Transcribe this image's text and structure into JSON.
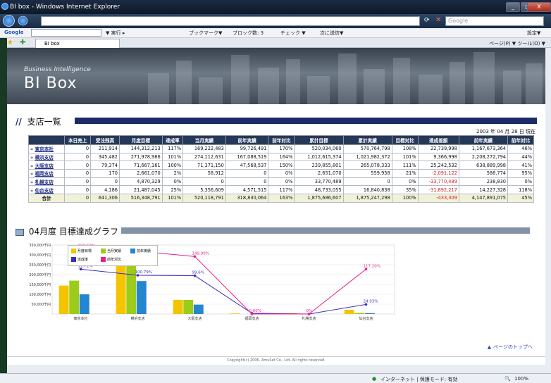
{
  "window": {
    "title": "BI box - Windows Internet Explorer",
    "min": "_",
    "max": "□",
    "close": "X"
  },
  "address": {
    "url": "",
    "search_placeholder": "Google"
  },
  "google_toolbar": {
    "brand": "Google",
    "items": [
      "▼ 実行 ▸",
      "ブックマーク▼",
      "ブロック数: 3",
      "チェック ▼",
      "次に送信▼"
    ],
    "settings": "設定▼"
  },
  "tabs": {
    "active": "BI box",
    "commands": "ページ(P) ▼ ツール(O) ▼"
  },
  "banner": {
    "subtitle": "Business Intelligence",
    "title": "BI Box"
  },
  "section1": {
    "title": "支店一覧"
  },
  "report_date": "2003 年 04 月 28 日 現在",
  "table": {
    "headers": [
      "",
      "本日売上",
      "受注残高",
      "月度目標",
      "達成率",
      "当月実績",
      "前年実績",
      "前年対比",
      "累計目標",
      "累計実績",
      "目標対比",
      "達成差額",
      "前年実績",
      "前年対比"
    ],
    "rows": [
      [
        "東京本社",
        "0",
        "211,914",
        "144,312,213",
        "117%",
        "169,222,483",
        "99,726,491",
        "170%",
        "520,034,060",
        "570,764,798",
        "108%",
        "22,739,998",
        "1,167,673,364",
        "46%"
      ],
      [
        "横浜支店",
        "0",
        "345,482",
        "271,978,986",
        "101%",
        "274,112,631",
        "167,088,519",
        "164%",
        "1,012,615,374",
        "1,021,982,372",
        "101%",
        "9,366,998",
        "2,208,272,794",
        "44%"
      ],
      [
        "大阪支店",
        "0",
        "79,374",
        "71,667,161",
        "100%",
        "71,371,150",
        "47,568,537",
        "150%",
        "239,855,801",
        "265,078,333",
        "111%",
        "25,242,532",
        "638,889,998",
        "41%"
      ],
      [
        "福岡支店",
        "0",
        "170",
        "2,661,070",
        "2%",
        "58,912",
        "0",
        "0%",
        "2,651,070",
        "559,958",
        "21%",
        "-2,091,122",
        "588,774",
        "95%"
      ],
      [
        "札幌支店",
        "0",
        "0",
        "4,870,329",
        "0%",
        "0",
        "0",
        "0%",
        "33,770,489",
        "0",
        "0%",
        "-33,770,489",
        "238,830",
        "0%"
      ],
      [
        "仙台支店",
        "0",
        "4,186",
        "21,487,045",
        "25%",
        "5,356,609",
        "4,571,515",
        "117%",
        "48,733,055",
        "16,840,838",
        "35%",
        "-31,892,217",
        "14,227,328",
        "118%"
      ],
      [
        "合計",
        "0",
        "641,306",
        "516,348,791",
        "101%",
        "520,118,791",
        "318,830,064",
        "163%",
        "1,875,686,607",
        "1,875,247,298",
        "100%",
        "-433,309",
        "4,147,891,075",
        "45%"
      ]
    ]
  },
  "section2": {
    "title": "04月度 目標達成グラフ"
  },
  "chart_data": {
    "type": "bar",
    "categories": [
      "東京本社",
      "横浜支店",
      "大阪支店",
      "福岡支店",
      "札幌支店",
      "仙台支店"
    ],
    "ylim": [
      0,
      350000000
    ],
    "yticks": [
      "350,000千円",
      "300,000千円",
      "250,000千円",
      "200,000千円",
      "150,000千円",
      "100,000千円",
      "50,000千円"
    ],
    "series": [
      {
        "name": "月度目標",
        "color": "#f4c400",
        "values": [
          144312213,
          271978986,
          71667161,
          2661070,
          4870329,
          21487045
        ]
      },
      {
        "name": "当月実績",
        "color": "#9ccc1a",
        "values": [
          169222483,
          274112631,
          71371150,
          58912,
          0,
          5356609
        ]
      },
      {
        "name": "前年実績",
        "color": "#2486cf",
        "values": [
          99726491,
          167088519,
          47568537,
          0,
          0,
          4571515
        ]
      }
    ],
    "lines": [
      {
        "name": "達成率",
        "color": "#3a2fc0",
        "values": [
          117,
          101,
          100,
          2,
          0,
          25
        ],
        "labels": [
          "117.2%",
          "100.79%",
          "99.6%",
          "",
          "",
          "24.93%"
        ]
      },
      {
        "name": "前年対比",
        "color": "#e8208a",
        "values": [
          170,
          164,
          150,
          0,
          0,
          117
        ],
        "labels": [
          "169.69%",
          "",
          "149.99%",
          "0.00%",
          "0%",
          "117.20%"
        ]
      }
    ]
  },
  "links": {
    "to_top": "ページのトップへ"
  },
  "footer": {
    "copyright": "Copyright(c) 2006- AmuSet Co., Ltd. All rights reserved."
  },
  "status": {
    "zone": "インターネット | 保護モード: 有効",
    "zoom": "100%"
  }
}
